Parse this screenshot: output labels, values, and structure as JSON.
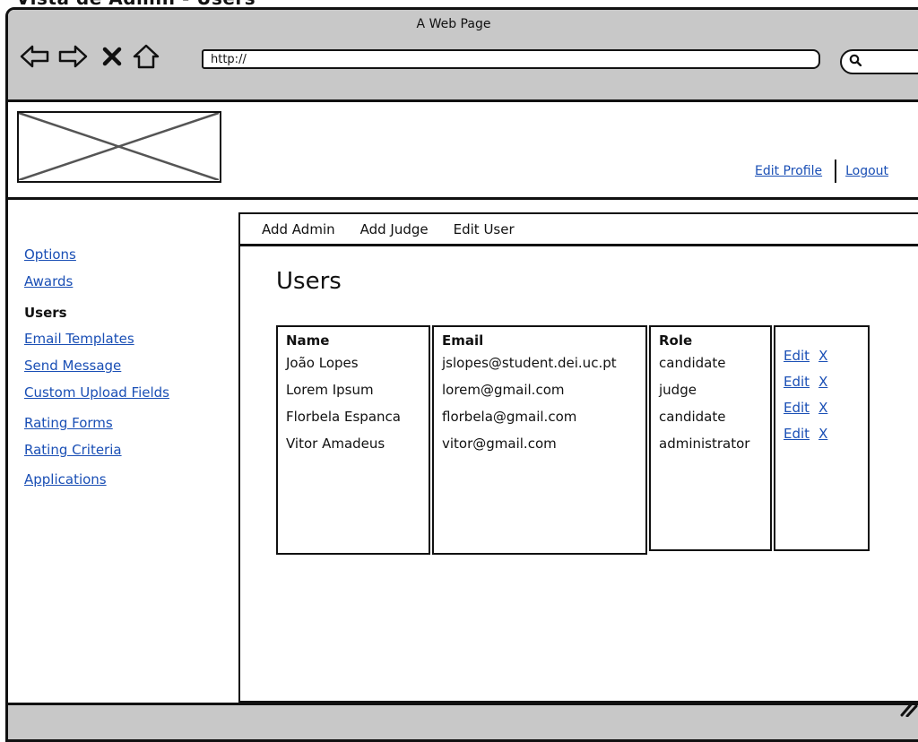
{
  "browser": {
    "title": "A Web Page",
    "url": "http://",
    "caption": "Vista de Admin - Users"
  },
  "header": {
    "links": [
      {
        "label": "Edit Profile"
      },
      {
        "label": "Logout"
      }
    ]
  },
  "sidebar": {
    "items": [
      {
        "label": "Options",
        "active": false
      },
      {
        "label": "Awards",
        "active": false
      },
      {
        "label": "Users",
        "active": true
      },
      {
        "label": "Email Templates",
        "active": false
      },
      {
        "label": "Send Message",
        "active": false
      },
      {
        "label": "Custom Upload Fields",
        "active": false
      },
      {
        "label": "Rating Forms",
        "active": false
      },
      {
        "label": "Rating Criteria",
        "active": false
      },
      {
        "label": "Applications",
        "active": false
      }
    ]
  },
  "tabs": [
    {
      "label": "Add Admin"
    },
    {
      "label": "Add Judge"
    },
    {
      "label": "Edit User"
    }
  ],
  "main": {
    "title": "Users",
    "table": {
      "headers": [
        "Name",
        "Email",
        "Role"
      ],
      "rows": [
        {
          "name": "João Lopes",
          "email": "jslopes@student.dei.uc.pt",
          "role": "candidate"
        },
        {
          "name": "Lorem Ipsum",
          "email": "lorem@gmail.com",
          "role": "judge"
        },
        {
          "name": "Florbela Espanca",
          "email": "florbela@gmail.com",
          "role": "candidate"
        },
        {
          "name": "Vitor Amadeus",
          "email": "vitor@gmail.com",
          "role": "administrator"
        }
      ],
      "edit_label": "Edit",
      "delete_label": "X"
    }
  },
  "colors": {
    "link": "#1a4fb5",
    "chrome": "#c8c8c8",
    "border": "#111111"
  }
}
